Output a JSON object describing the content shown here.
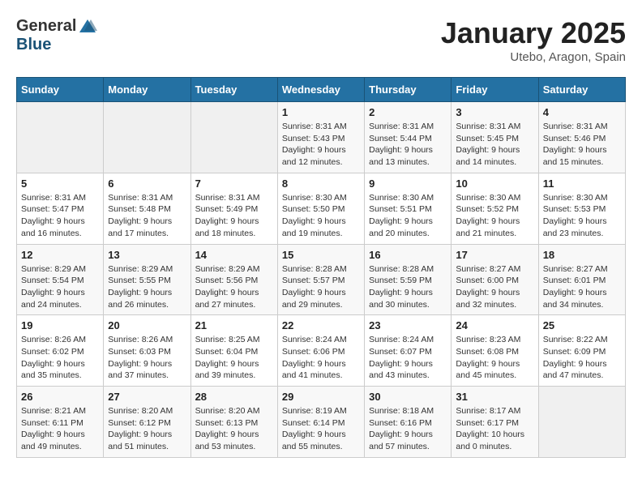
{
  "logo": {
    "general": "General",
    "blue": "Blue"
  },
  "title": "January 2025",
  "subtitle": "Utebo, Aragon, Spain",
  "days_of_week": [
    "Sunday",
    "Monday",
    "Tuesday",
    "Wednesday",
    "Thursday",
    "Friday",
    "Saturday"
  ],
  "weeks": [
    [
      {
        "day": "",
        "info": ""
      },
      {
        "day": "",
        "info": ""
      },
      {
        "day": "",
        "info": ""
      },
      {
        "day": "1",
        "info": "Sunrise: 8:31 AM\nSunset: 5:43 PM\nDaylight: 9 hours and 12 minutes."
      },
      {
        "day": "2",
        "info": "Sunrise: 8:31 AM\nSunset: 5:44 PM\nDaylight: 9 hours and 13 minutes."
      },
      {
        "day": "3",
        "info": "Sunrise: 8:31 AM\nSunset: 5:45 PM\nDaylight: 9 hours and 14 minutes."
      },
      {
        "day": "4",
        "info": "Sunrise: 8:31 AM\nSunset: 5:46 PM\nDaylight: 9 hours and 15 minutes."
      }
    ],
    [
      {
        "day": "5",
        "info": "Sunrise: 8:31 AM\nSunset: 5:47 PM\nDaylight: 9 hours and 16 minutes."
      },
      {
        "day": "6",
        "info": "Sunrise: 8:31 AM\nSunset: 5:48 PM\nDaylight: 9 hours and 17 minutes."
      },
      {
        "day": "7",
        "info": "Sunrise: 8:31 AM\nSunset: 5:49 PM\nDaylight: 9 hours and 18 minutes."
      },
      {
        "day": "8",
        "info": "Sunrise: 8:30 AM\nSunset: 5:50 PM\nDaylight: 9 hours and 19 minutes."
      },
      {
        "day": "9",
        "info": "Sunrise: 8:30 AM\nSunset: 5:51 PM\nDaylight: 9 hours and 20 minutes."
      },
      {
        "day": "10",
        "info": "Sunrise: 8:30 AM\nSunset: 5:52 PM\nDaylight: 9 hours and 21 minutes."
      },
      {
        "day": "11",
        "info": "Sunrise: 8:30 AM\nSunset: 5:53 PM\nDaylight: 9 hours and 23 minutes."
      }
    ],
    [
      {
        "day": "12",
        "info": "Sunrise: 8:29 AM\nSunset: 5:54 PM\nDaylight: 9 hours and 24 minutes."
      },
      {
        "day": "13",
        "info": "Sunrise: 8:29 AM\nSunset: 5:55 PM\nDaylight: 9 hours and 26 minutes."
      },
      {
        "day": "14",
        "info": "Sunrise: 8:29 AM\nSunset: 5:56 PM\nDaylight: 9 hours and 27 minutes."
      },
      {
        "day": "15",
        "info": "Sunrise: 8:28 AM\nSunset: 5:57 PM\nDaylight: 9 hours and 29 minutes."
      },
      {
        "day": "16",
        "info": "Sunrise: 8:28 AM\nSunset: 5:59 PM\nDaylight: 9 hours and 30 minutes."
      },
      {
        "day": "17",
        "info": "Sunrise: 8:27 AM\nSunset: 6:00 PM\nDaylight: 9 hours and 32 minutes."
      },
      {
        "day": "18",
        "info": "Sunrise: 8:27 AM\nSunset: 6:01 PM\nDaylight: 9 hours and 34 minutes."
      }
    ],
    [
      {
        "day": "19",
        "info": "Sunrise: 8:26 AM\nSunset: 6:02 PM\nDaylight: 9 hours and 35 minutes."
      },
      {
        "day": "20",
        "info": "Sunrise: 8:26 AM\nSunset: 6:03 PM\nDaylight: 9 hours and 37 minutes."
      },
      {
        "day": "21",
        "info": "Sunrise: 8:25 AM\nSunset: 6:04 PM\nDaylight: 9 hours and 39 minutes."
      },
      {
        "day": "22",
        "info": "Sunrise: 8:24 AM\nSunset: 6:06 PM\nDaylight: 9 hours and 41 minutes."
      },
      {
        "day": "23",
        "info": "Sunrise: 8:24 AM\nSunset: 6:07 PM\nDaylight: 9 hours and 43 minutes."
      },
      {
        "day": "24",
        "info": "Sunrise: 8:23 AM\nSunset: 6:08 PM\nDaylight: 9 hours and 45 minutes."
      },
      {
        "day": "25",
        "info": "Sunrise: 8:22 AM\nSunset: 6:09 PM\nDaylight: 9 hours and 47 minutes."
      }
    ],
    [
      {
        "day": "26",
        "info": "Sunrise: 8:21 AM\nSunset: 6:11 PM\nDaylight: 9 hours and 49 minutes."
      },
      {
        "day": "27",
        "info": "Sunrise: 8:20 AM\nSunset: 6:12 PM\nDaylight: 9 hours and 51 minutes."
      },
      {
        "day": "28",
        "info": "Sunrise: 8:20 AM\nSunset: 6:13 PM\nDaylight: 9 hours and 53 minutes."
      },
      {
        "day": "29",
        "info": "Sunrise: 8:19 AM\nSunset: 6:14 PM\nDaylight: 9 hours and 55 minutes."
      },
      {
        "day": "30",
        "info": "Sunrise: 8:18 AM\nSunset: 6:16 PM\nDaylight: 9 hours and 57 minutes."
      },
      {
        "day": "31",
        "info": "Sunrise: 8:17 AM\nSunset: 6:17 PM\nDaylight: 10 hours and 0 minutes."
      },
      {
        "day": "",
        "info": ""
      }
    ]
  ]
}
